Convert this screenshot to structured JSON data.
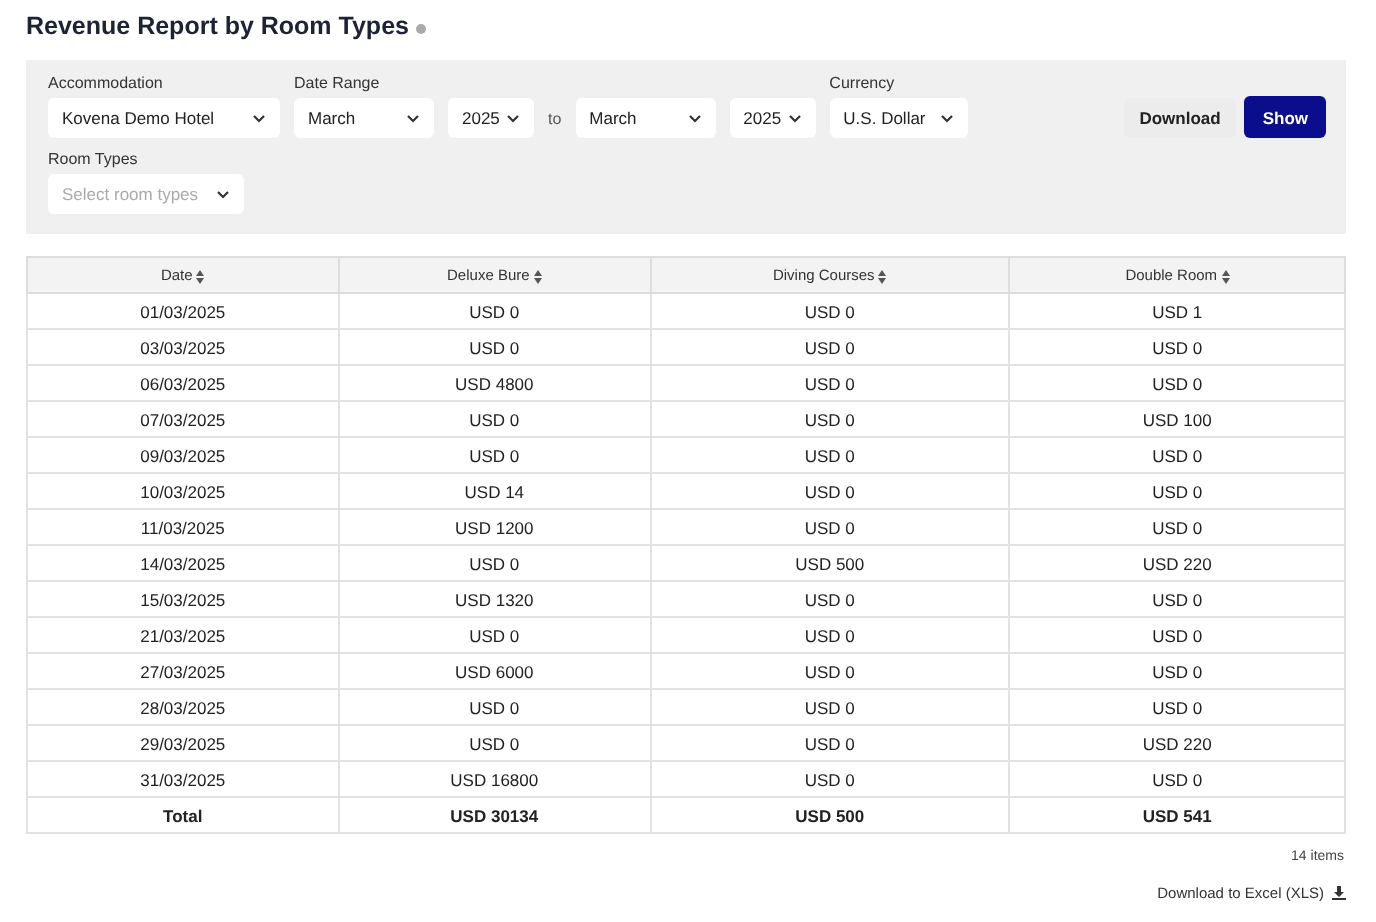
{
  "title": "Revenue Report by Room Types",
  "filters": {
    "accommodation": {
      "label": "Accommodation",
      "value": "Kovena Demo Hotel"
    },
    "date_range": {
      "label": "Date Range",
      "from_month": "March",
      "from_year": "2025",
      "separator": "to",
      "to_month": "March",
      "to_year": "2025"
    },
    "currency": {
      "label": "Currency",
      "value": "U.S. Dollar"
    },
    "room_types": {
      "label": "Room Types",
      "placeholder": "Select room types"
    }
  },
  "buttons": {
    "download": "Download",
    "show": "Show"
  },
  "table": {
    "columns": [
      "Date",
      "Deluxe Bure",
      "Diving Courses",
      "Double Room"
    ],
    "rows": [
      [
        "01/03/2025",
        "USD 0",
        "USD 0",
        "USD 1"
      ],
      [
        "03/03/2025",
        "USD 0",
        "USD 0",
        "USD 0"
      ],
      [
        "06/03/2025",
        "USD 4800",
        "USD 0",
        "USD 0"
      ],
      [
        "07/03/2025",
        "USD 0",
        "USD 0",
        "USD 100"
      ],
      [
        "09/03/2025",
        "USD 0",
        "USD 0",
        "USD 0"
      ],
      [
        "10/03/2025",
        "USD 14",
        "USD 0",
        "USD 0"
      ],
      [
        "11/03/2025",
        "USD 1200",
        "USD 0",
        "USD 0"
      ],
      [
        "14/03/2025",
        "USD 0",
        "USD 500",
        "USD 220"
      ],
      [
        "15/03/2025",
        "USD 1320",
        "USD 0",
        "USD 0"
      ],
      [
        "21/03/2025",
        "USD 0",
        "USD 0",
        "USD 0"
      ],
      [
        "27/03/2025",
        "USD 6000",
        "USD 0",
        "USD 0"
      ],
      [
        "28/03/2025",
        "USD 0",
        "USD 0",
        "USD 0"
      ],
      [
        "29/03/2025",
        "USD 0",
        "USD 0",
        "USD 220"
      ],
      [
        "31/03/2025",
        "USD 16800",
        "USD 0",
        "USD 0"
      ]
    ],
    "total": [
      "Total",
      "USD 30134",
      "USD 500",
      "USD 541"
    ]
  },
  "item_count": "14 items",
  "excel_link": "Download to Excel (XLS)"
}
